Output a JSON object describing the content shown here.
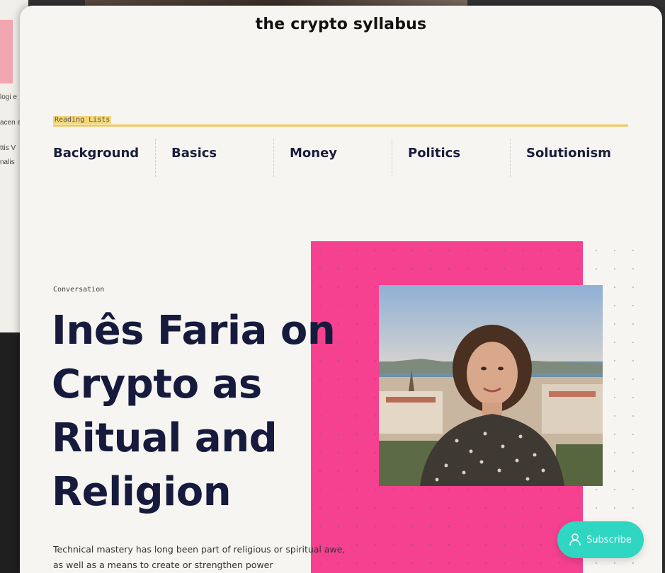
{
  "background": {
    "left_text": [
      "logi e",
      "acen e",
      "ttis V",
      "nalis"
    ]
  },
  "site": {
    "title": "the crypto syllabus"
  },
  "reading_lists": {
    "label": "Reading Lists",
    "items": [
      {
        "label": "Background"
      },
      {
        "label": "Basics"
      },
      {
        "label": "Money"
      },
      {
        "label": "Politics"
      },
      {
        "label": "Solutionism"
      }
    ]
  },
  "article": {
    "kicker": "Conversation",
    "headline": "Inês Faria on Crypto as Ritual and Religion",
    "excerpt": "Technical mastery has long been part of religious or spiritual awe, as well as a means to create or strengthen power"
  },
  "subscribe": {
    "label": "Subscribe",
    "icon": "user-icon"
  },
  "colors": {
    "accent_pink": "#f5418f",
    "accent_yellow": "#f0c85a",
    "subscribe_teal": "#2fd6c1",
    "headline_navy": "#161a3d"
  }
}
